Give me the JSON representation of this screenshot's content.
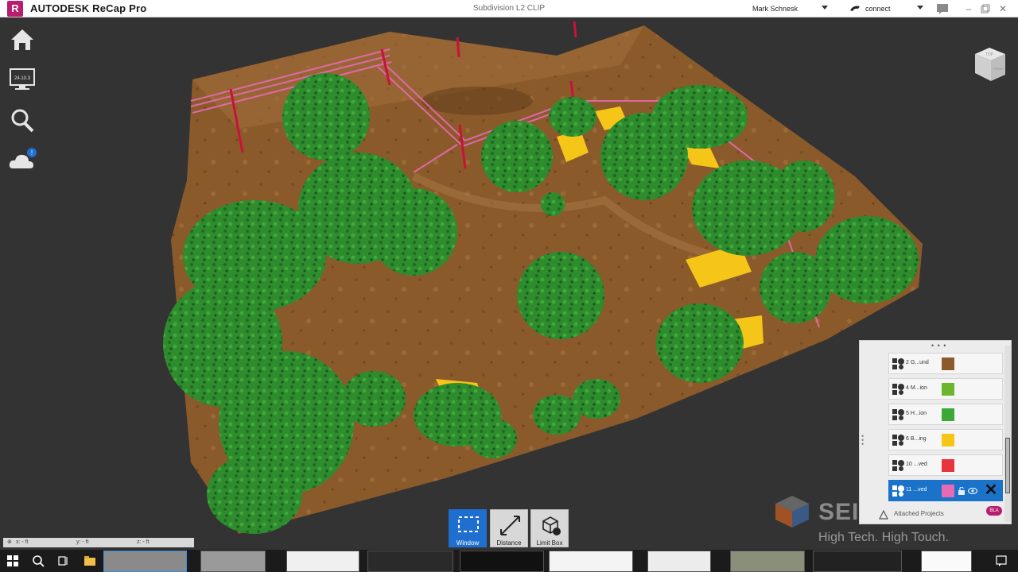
{
  "titlebar": {
    "logo_letter": "R",
    "app_name": "AUTODESK ReCap Pro",
    "document_title": "Subdivision L2 CLIP",
    "user_name": "Mark Schnesk",
    "connect_label": "connect"
  },
  "left_toolbar": {
    "items": [
      {
        "icon": "home-icon"
      },
      {
        "icon": "monitor-icon",
        "screen_text": "24.10.3"
      },
      {
        "icon": "search-icon"
      },
      {
        "icon": "cloud-icon",
        "badge": "!"
      }
    ]
  },
  "navcube": {
    "face_top": "TOP",
    "face_front": "FRONT"
  },
  "layers_panel": {
    "rows": [
      {
        "label": "2 G...und",
        "color": "#8b5a2b"
      },
      {
        "label": "4 M...ion",
        "color": "#6cb52d"
      },
      {
        "label": "5 H...ion",
        "color": "#3aa935"
      },
      {
        "label": "6 B...ing",
        "color": "#f5c518"
      },
      {
        "label": "10 ...ved",
        "color": "#e8353d"
      },
      {
        "label": "11 ...ved",
        "color": "#e76ab4",
        "selected": true
      }
    ],
    "badge_text": "BLA",
    "attached_label": "Attached Projects"
  },
  "watermark": {
    "brand": "SEILER",
    "tagline": "High Tech. High Touch."
  },
  "selection_tools": [
    {
      "label": "Window",
      "icon": "window-select-icon",
      "active": true
    },
    {
      "label": "Distance",
      "icon": "distance-icon",
      "active": false
    },
    {
      "label": "Limit Box",
      "icon": "limit-box-icon",
      "active": false
    }
  ],
  "coords": {
    "x": "x: - ft",
    "y": "y: - ft",
    "z": "z: - ft"
  },
  "colors": {
    "accent": "#1e6fd0",
    "brand": "#b81d6f",
    "ground": "#8b5a2b",
    "vegetation": "#2e8b2e",
    "building": "#f5c518",
    "powerline": "#e76ab4",
    "background": "#333333"
  }
}
